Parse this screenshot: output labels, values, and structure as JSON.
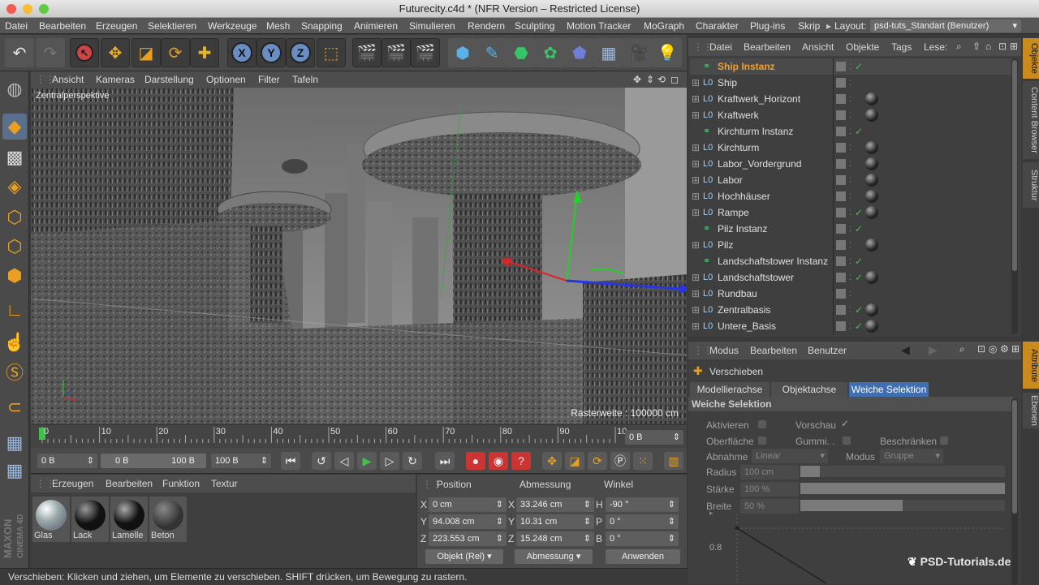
{
  "window": {
    "title": "Futurecity.c4d * (NFR Version – Restricted License)"
  },
  "menubar": {
    "items": [
      "Datei",
      "Bearbeiten",
      "Erzeugen",
      "Selektieren",
      "Werkzeuge",
      "Mesh",
      "Snapping",
      "Animieren",
      "Simulieren",
      "Rendern",
      "Sculpting",
      "Motion Tracker",
      "MoGraph",
      "Charakter",
      "Plug-ins",
      "Skrip"
    ],
    "layout_label": "Layout:",
    "layout_value": "psd-tuts_Standart (Benutzer)"
  },
  "viewport": {
    "menu": [
      "Ansicht",
      "Kameras",
      "Darstellung",
      "Optionen",
      "Filter",
      "Tafeln"
    ],
    "camera_label": "Zentralperspektive",
    "grid_label": "Rasterweite : 100000 cm"
  },
  "timeline": {
    "ticks": [
      "0",
      "10",
      "20",
      "30",
      "40",
      "50",
      "60",
      "70",
      "80",
      "90",
      "10"
    ],
    "frame_field": "0 B"
  },
  "transport": {
    "start": "0 B",
    "range_start": "0 B",
    "range_end": "100 B",
    "end": "100 B"
  },
  "materials": {
    "menu": [
      "Erzeugen",
      "Bearbeiten",
      "Funktion",
      "Textur"
    ],
    "items": [
      "Glas",
      "Lack",
      "Lamelle",
      "Beton"
    ]
  },
  "coords": {
    "headers": [
      "Position",
      "Abmessung",
      "Winkel"
    ],
    "rows": [
      {
        "a": "X",
        "v1": "0 cm",
        "b": "X",
        "v2": "33.246 cm",
        "c": "H",
        "v3": "-90 °"
      },
      {
        "a": "Y",
        "v1": "94.008 cm",
        "b": "Y",
        "v2": "10.31 cm",
        "c": "P",
        "v3": "0 °"
      },
      {
        "a": "Z",
        "v1": "223.553 cm",
        "b": "Z",
        "v2": "15.248 cm",
        "c": "B",
        "v3": "0 °"
      }
    ],
    "mode1": "Objekt (Rel)",
    "mode2": "Abmessung",
    "apply": "Anwenden"
  },
  "status": "Verschieben: Klicken und ziehen, um Elemente zu verschieben. SHIFT drücken, um Bewegung zu rastern.",
  "objects": {
    "menu": [
      "Datei",
      "Bearbeiten",
      "Ansicht",
      "Objekte",
      "Tags",
      "Lese:"
    ],
    "items": [
      {
        "name": "Ship Instanz",
        "selected": true,
        "check": true,
        "mat": false
      },
      {
        "name": "Ship",
        "check": false,
        "mat": false
      },
      {
        "name": "Kraftwerk_Horizont",
        "check": false,
        "mat": true
      },
      {
        "name": "Kraftwerk",
        "check": false,
        "mat": true
      },
      {
        "name": "Kirchturm Instanz",
        "check": true,
        "mat": false
      },
      {
        "name": "Kirchturm",
        "check": false,
        "mat": true
      },
      {
        "name": "Labor_Vordergrund",
        "check": false,
        "mat": true
      },
      {
        "name": "Labor",
        "check": false,
        "mat": true
      },
      {
        "name": "Hochhäuser",
        "check": false,
        "mat": true
      },
      {
        "name": "Rampe",
        "check": true,
        "mat": true
      },
      {
        "name": "Pilz Instanz",
        "check": true,
        "mat": false
      },
      {
        "name": "Pilz",
        "check": false,
        "mat": true
      },
      {
        "name": "Landschaftstower Instanz",
        "check": true,
        "mat": false
      },
      {
        "name": "Landschaftstower",
        "check": true,
        "mat": true
      },
      {
        "name": "Rundbau",
        "check": false,
        "mat": false
      },
      {
        "name": "Zentralbasis",
        "check": true,
        "mat": true
      },
      {
        "name": "Untere_Basis",
        "check": true,
        "mat": true
      }
    ]
  },
  "attributes": {
    "menu": [
      "Modus",
      "Bearbeiten",
      "Benutzer"
    ],
    "tool": "Verschieben",
    "tabs": [
      "Modellierachse",
      "Objektachse",
      "Weiche Selektion"
    ],
    "section": "Weiche Selektion",
    "aktivieren": "Aktivieren",
    "vorschau": "Vorschau",
    "oberflaeche": "Oberfläche",
    "gummi": "Gummi. .",
    "beschraenken": "Beschränken",
    "abnahme": "Abnahme",
    "abnahme_val": "Linear",
    "modus": "Modus",
    "modus_val": "Gruppe",
    "radius": "Radius",
    "radius_val": "100 cm",
    "staerke": "Stärke",
    "staerke_val": "100 %",
    "breite": "Breite",
    "breite_val": "50 %",
    "graph_tick": "0.8"
  },
  "side_tabs": [
    "Objekte",
    "Content Browser",
    "Struktur",
    "Attribute",
    "Ebenen"
  ],
  "brand": {
    "maxon": "MAXON",
    "cinema": "CINEMA 4D",
    "watermark": "PSD-Tutorials.de"
  }
}
